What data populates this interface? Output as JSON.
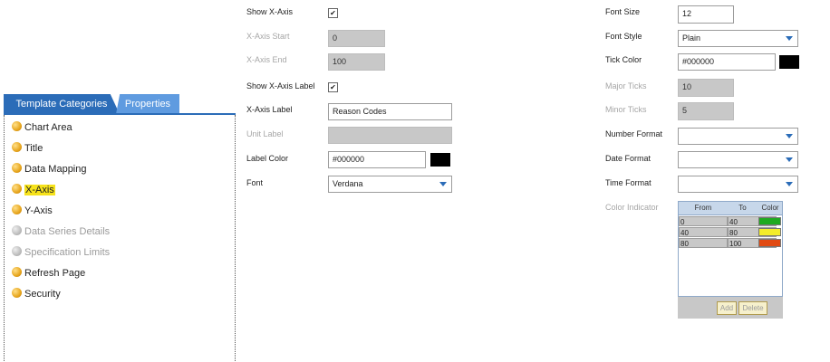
{
  "left_panel": {
    "tabs": [
      {
        "label": "Template Categories"
      },
      {
        "label": "Properties"
      }
    ],
    "categories": [
      {
        "label": "Chart Area",
        "state": "enabled"
      },
      {
        "label": "Title",
        "state": "enabled"
      },
      {
        "label": "Data Mapping",
        "state": "enabled"
      },
      {
        "label": "X-Axis",
        "state": "selected"
      },
      {
        "label": "Y-Axis",
        "state": "enabled"
      },
      {
        "label": "Data Series Details",
        "state": "disabled"
      },
      {
        "label": "Specification Limits",
        "state": "disabled"
      },
      {
        "label": "Refresh Page",
        "state": "enabled"
      },
      {
        "label": "Security",
        "state": "enabled"
      }
    ]
  },
  "form_left": {
    "show_x_axis": {
      "label": "Show X-Axis",
      "checked": true
    },
    "x_axis_start": {
      "label": "X-Axis Start",
      "value": "0"
    },
    "x_axis_end": {
      "label": "X-Axis End",
      "value": "100"
    },
    "show_x_axis_label": {
      "label": "Show X-Axis Label",
      "checked": true
    },
    "x_axis_label": {
      "label": "X-Axis Label",
      "value": "Reason Codes"
    },
    "unit_label": {
      "label": "Unit Label",
      "value": ""
    },
    "label_color": {
      "label": "Label Color",
      "value": "#000000",
      "swatch": "#000000"
    },
    "font": {
      "label": "Font",
      "value": "Verdana"
    }
  },
  "form_right": {
    "font_size": {
      "label": "Font Size",
      "value": "12"
    },
    "font_style": {
      "label": "Font Style",
      "value": "Plain"
    },
    "tick_color": {
      "label": "Tick Color",
      "value": "#000000",
      "swatch": "#000000"
    },
    "major_ticks": {
      "label": "Major Ticks",
      "value": "10"
    },
    "minor_ticks": {
      "label": "Minor Ticks",
      "value": "5"
    },
    "number_format": {
      "label": "Number Format",
      "value": ""
    },
    "date_format": {
      "label": "Date Format",
      "value": ""
    },
    "time_format": {
      "label": "Time Format",
      "value": ""
    },
    "color_indicator": {
      "label": "Color Indicator",
      "headers": {
        "from": "From",
        "to": "To",
        "color": "Color"
      },
      "rows": [
        {
          "from": "0",
          "to": "40",
          "color": "#1faa1f"
        },
        {
          "from": "40",
          "to": "80",
          "color": "#f3ec2a"
        },
        {
          "from": "80",
          "to": "100",
          "color": "#e14a12"
        }
      ],
      "add_label": "Add",
      "delete_label": "Delete"
    }
  },
  "colors": {
    "tab_active": "#2b6cb8",
    "tab_inactive": "#5f9be0",
    "selected_highlight": "#f6e21b"
  }
}
